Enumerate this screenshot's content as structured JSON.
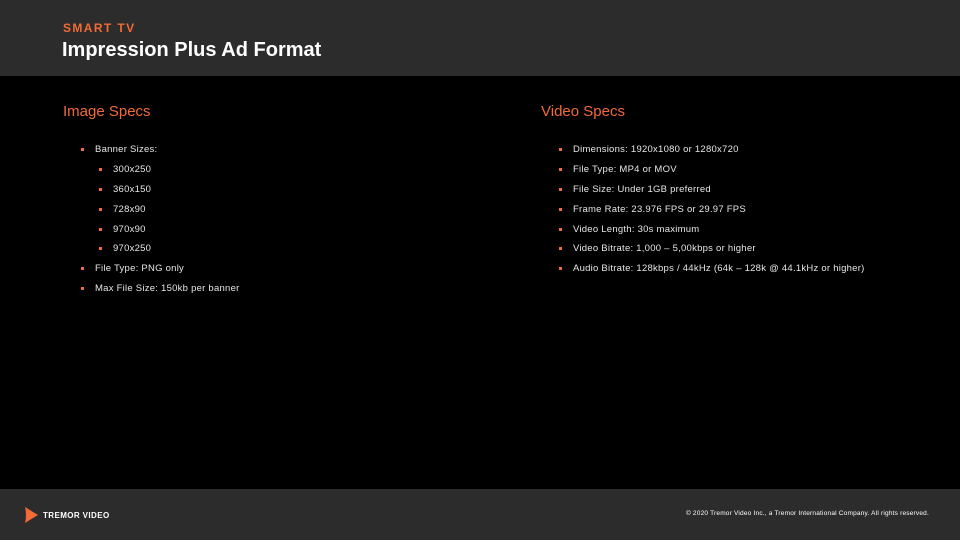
{
  "header": {
    "eyebrow": "SMART TV",
    "title": "Impression Plus Ad Format"
  },
  "image_specs": {
    "heading": "Image Specs",
    "banner_sizes_label": "Banner Sizes:",
    "banner_sizes": [
      "300x250",
      "360x150",
      "728x90",
      "970x90",
      "970x250"
    ],
    "file_type": "File Type: PNG only",
    "max_file_size": "Max File Size: 150kb per banner"
  },
  "video_specs": {
    "heading": "Video Specs",
    "items": [
      "Dimensions: 1920x1080 or 1280x720",
      "File Type: MP4 or MOV",
      "File Size: Under 1GB preferred",
      "Frame Rate: 23.976 FPS or 29.97 FPS",
      "Video Length: 30s maximum",
      "Video Bitrate: 1,000 – 5,00kbps or higher",
      "Audio Bitrate: 128kbps / 44kHz (64k – 128k @ 44.1kHz or higher)"
    ]
  },
  "footer": {
    "logo_text": "TREMOR VIDEO",
    "copyright": "© 2020 Tremor Video Inc., a Tremor International Company. All rights reserved."
  },
  "colors": {
    "accent": "#f26a36",
    "header_bg": "#2c2c2c",
    "background": "#000000"
  }
}
